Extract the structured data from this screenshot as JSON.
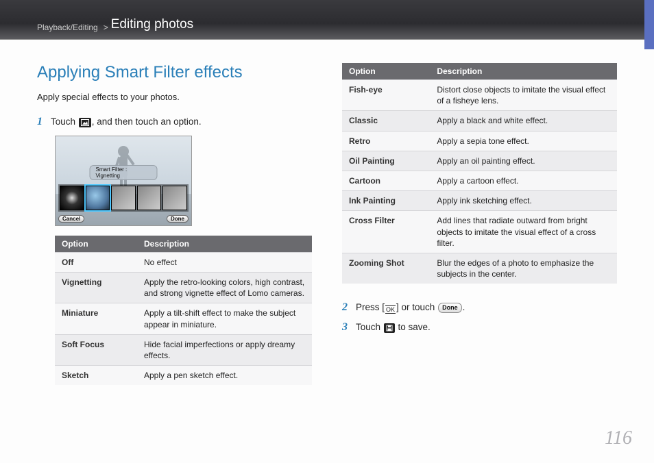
{
  "breadcrumb": {
    "section": "Playback/Editing",
    "sep": ">",
    "page": "Editing photos"
  },
  "heading": "Applying Smart Filter effects",
  "intro": "Apply special effects to your photos.",
  "steps": {
    "s1": {
      "num": "1",
      "pre": "Touch ",
      "post": ", and then touch an option."
    },
    "s2": {
      "num": "2",
      "pre": "Press [",
      "mid": "] or touch ",
      "done": "Done",
      "post": "."
    },
    "s3": {
      "num": "3",
      "pre": "Touch ",
      "post": " to save."
    }
  },
  "shot": {
    "label": "Smart Filter : Vignetting",
    "cancel": "Cancel",
    "done": "Done"
  },
  "tableHeaders": {
    "option": "Option",
    "description": "Description"
  },
  "leftTable": [
    {
      "name": "Off",
      "desc": "No effect"
    },
    {
      "name": "Vignetting",
      "desc": "Apply the retro-looking colors, high contrast, and strong vignette effect of Lomo cameras."
    },
    {
      "name": "Miniature",
      "desc": "Apply a tilt-shift effect to make the subject appear in miniature."
    },
    {
      "name": "Soft Focus",
      "desc": "Hide facial imperfections or apply dreamy effects."
    },
    {
      "name": "Sketch",
      "desc": "Apply a pen sketch effect."
    }
  ],
  "rightTable": [
    {
      "name": "Fish-eye",
      "desc": "Distort close objects to imitate the visual effect of a fisheye lens."
    },
    {
      "name": "Classic",
      "desc": "Apply a black and white effect."
    },
    {
      "name": "Retro",
      "desc": "Apply a sepia tone effect."
    },
    {
      "name": "Oil Painting",
      "desc": "Apply an oil painting effect."
    },
    {
      "name": "Cartoon",
      "desc": "Apply a cartoon effect."
    },
    {
      "name": "Ink Painting",
      "desc": "Apply ink sketching effect."
    },
    {
      "name": "Cross Filter",
      "desc": "Add lines that radiate outward from bright objects to imitate the visual effect of a cross filter."
    },
    {
      "name": "Zooming Shot",
      "desc": "Blur the edges of a photo to emphasize the subjects in the center."
    }
  ],
  "ok": "OK",
  "pageNumber": "116"
}
